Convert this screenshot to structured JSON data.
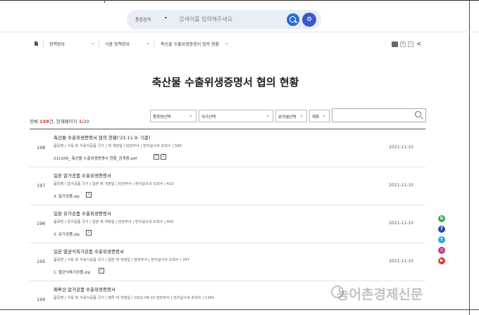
{
  "search": {
    "category": "통합검색",
    "caret": "▾",
    "placeholder": "검색어를 입력해주세요",
    "settings_glyph": "⚙"
  },
  "breadcrumb": {
    "home_icon": "home-icon",
    "items": [
      "정책정보",
      "식품 정책정보",
      "축산물 수출위생증명서 협의 현황"
    ],
    "chevron": "⌄"
  },
  "tools": {
    "plus": "+",
    "minus": "−",
    "share_glyph": "<"
  },
  "page": {
    "title": "축산물 수출위생증명서 협의 현황"
  },
  "summary": {
    "prefix": "전체 ",
    "total": "198",
    "middle": "건, 현재페이지 ",
    "current_page": "1",
    "suffix": "/20"
  },
  "filters": {
    "select1": "품목명선택",
    "select2": "국가선택",
    "select3": "분야별선택",
    "select4": "제목",
    "chevron": "⌄"
  },
  "rows": [
    {
      "num": "198",
      "title": "축산물 수출위생증명서 협의 현황('21.11.9. 기준)",
      "meta": "품목명 | 식육 및 식육가공품    국가 |    재 개정일 |    담당부서 | 현지실사과    조회수 | 596",
      "file": "211109_ 축산물 수출위생증명서 현황_공개용.pdf",
      "date": "2021-11-10"
    },
    {
      "num": "197",
      "title": "일본 알가공품 수출위생증명서",
      "meta": "품목명 | 알가공품    국가 | 일본    재 개정일 |    담당부서 | 현지실사과    조회수 | 410",
      "file": "3. 알가공품.zip",
      "date": "2021-11-10"
    },
    {
      "num": "196",
      "title": "일본 유가공품 수출위생증명서",
      "meta": "품목명 | 유가공품    국가 | 일본    재 개정일 |    담당부서 | 현지실사과    조회수 | 405",
      "file": "2. 유가공품.zip",
      "date": "2021-11-10"
    },
    {
      "num": "195",
      "title": "일본 멸균식육가공품 수출위생증명서",
      "meta": "품목명 | 식육 및 식육가공품    국가 | 일본    재 개정일 |    담당부서 | 현지실사과    조회수 | 397",
      "file": "1. 멸균식육가공품.zip",
      "date": "2021-11-10"
    },
    {
      "num": "194",
      "title": "패루산 알가공품 수출위생증명서",
      "meta": "품목명 | 식육 및 식육가공품    국가 | 페루    재 개정일 | 2021-08-10    담당부서 | 현지실사과    조회수 | 1360",
      "file": "",
      "date": ""
    }
  ],
  "social": [
    {
      "icon": "band-icon",
      "glyph": "b",
      "color": "#35b44a"
    },
    {
      "icon": "facebook-icon",
      "glyph": "f",
      "color": "#1f4da8"
    },
    {
      "icon": "twitter-icon",
      "glyph": "t",
      "color": "#2aa9e0"
    },
    {
      "icon": "instagram-icon",
      "glyph": "◎",
      "color": "#c8327a"
    },
    {
      "icon": "youtube-icon",
      "glyph": "▶",
      "color": "#e23a2a"
    }
  ],
  "watermark": {
    "text": "농어촌경제신문"
  },
  "colors": {
    "accent": "#2b6fd6",
    "count_red": "#d83a1a",
    "settings": "#3e57c8"
  }
}
